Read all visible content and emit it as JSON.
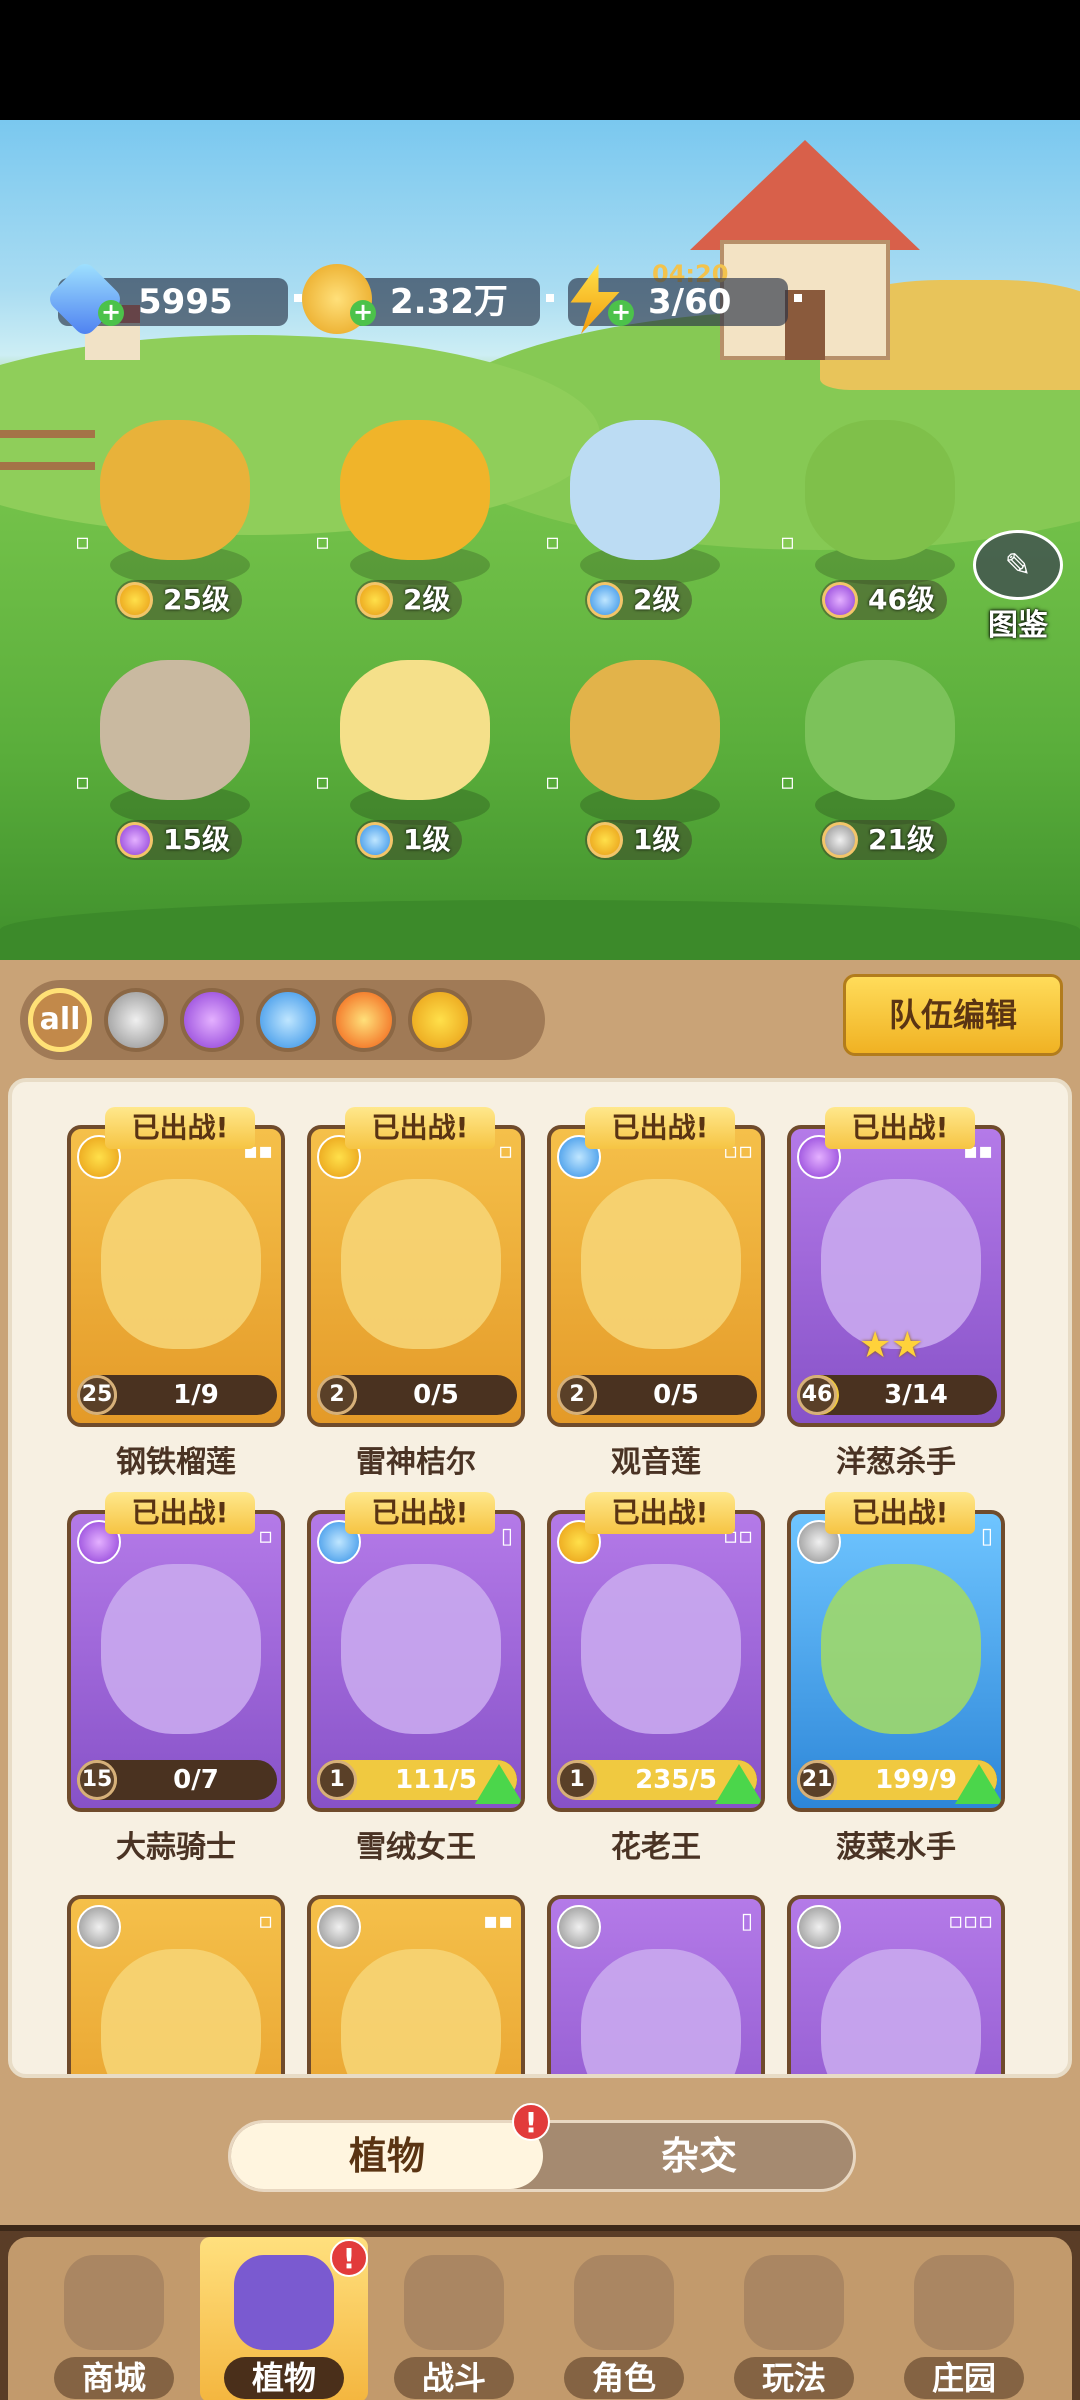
{
  "resources": {
    "gems": "5995",
    "coins": "2.32万",
    "energy": "3/60",
    "energy_timer": "04:20"
  },
  "atlas_label": "图鉴",
  "field_plants": [
    {
      "level": "25级",
      "element": "thunder",
      "color": "#e8b23a"
    },
    {
      "level": "2级",
      "element": "thunder",
      "color": "#f0b42a"
    },
    {
      "level": "2级",
      "element": "water",
      "color": "#bcdcf3"
    },
    {
      "level": "46级",
      "element": "poison",
      "color": "#7fc04a"
    },
    {
      "level": "15级",
      "element": "poison",
      "color": "#c9b9a0"
    },
    {
      "level": "1级",
      "element": "water",
      "color": "#f5e08a"
    },
    {
      "level": "1级",
      "element": "thunder",
      "color": "#e2b34a"
    },
    {
      "level": "21级",
      "element": "sword",
      "color": "#7cc25a"
    }
  ],
  "filter": {
    "all_label": "all",
    "elements": [
      "sword",
      "poison",
      "water",
      "fire",
      "thunder"
    ]
  },
  "team_edit_label": "队伍编辑",
  "deployed_label": "已出战!",
  "cards": [
    {
      "name": "钢铁榴莲",
      "level": "25",
      "progress": "1/9",
      "progress_fraction": 0.11,
      "rarity": "gold",
      "element": "thunder",
      "slots": "▪▪",
      "deployed": true,
      "upgrade": false
    },
    {
      "name": "雷神桔尔",
      "level": "2",
      "progress": "0/5",
      "progress_fraction": 0.0,
      "rarity": "gold",
      "element": "thunder",
      "slots": "▫",
      "deployed": true,
      "upgrade": false
    },
    {
      "name": "观音莲",
      "level": "2",
      "progress": "0/5",
      "progress_fraction": 0.0,
      "rarity": "gold",
      "element": "water",
      "slots": "▫▫",
      "deployed": true,
      "upgrade": false
    },
    {
      "name": "洋葱杀手",
      "level": "46",
      "progress": "3/14",
      "progress_fraction": 0.21,
      "rarity": "purple",
      "element": "poison",
      "slots": "▪▪",
      "deployed": true,
      "upgrade": false,
      "stars": "★★"
    },
    {
      "name": "大蒜骑士",
      "level": "15",
      "progress": "0/7",
      "progress_fraction": 0.0,
      "rarity": "purple",
      "element": "poison",
      "slots": "▫",
      "deployed": true,
      "upgrade": false
    },
    {
      "name": "雪绒女王",
      "level": "1",
      "progress": "111/5",
      "progress_fraction": 1.0,
      "rarity": "purple",
      "element": "water",
      "slots": "▯",
      "deployed": true,
      "upgrade": true
    },
    {
      "name": "花老王",
      "level": "1",
      "progress": "235/5",
      "progress_fraction": 1.0,
      "rarity": "purple",
      "element": "thunder",
      "slots": "▫▫",
      "deployed": true,
      "upgrade": true
    },
    {
      "name": "菠菜水手",
      "level": "21",
      "progress": "199/9",
      "progress_fraction": 1.0,
      "rarity": "blue",
      "element": "sword",
      "slots": "▯",
      "deployed": true,
      "upgrade": true
    },
    {
      "name": "",
      "rarity": "gold",
      "element": "sword",
      "slots": "▫"
    },
    {
      "name": "",
      "rarity": "gold",
      "element": "sword",
      "slots": "▪▪"
    },
    {
      "name": "",
      "rarity": "purple",
      "element": "sword",
      "slots": "▯"
    },
    {
      "name": "",
      "rarity": "purple",
      "element": "sword",
      "slots": "▫▫▫"
    }
  ],
  "toggle": {
    "plants": "植物",
    "hybrid": "杂交"
  },
  "badge_mark": "!",
  "nav": [
    {
      "label": "商城",
      "active": false
    },
    {
      "label": "植物",
      "active": true
    },
    {
      "label": "战斗",
      "active": false
    },
    {
      "label": "角色",
      "active": false
    },
    {
      "label": "玩法",
      "active": false
    },
    {
      "label": "庄园",
      "active": false
    }
  ],
  "colors": {
    "accent_gold": "#f0b223",
    "panel_brown": "#c9a377",
    "upgrade_green": "#4bd64b",
    "badge_red": "#e23b3b"
  }
}
